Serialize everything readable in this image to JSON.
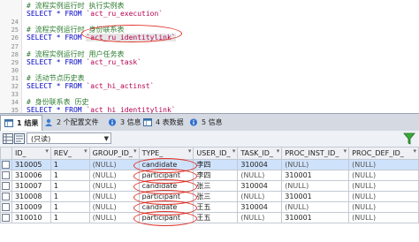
{
  "editor": {
    "lines": [
      {
        "n": "",
        "kind": "comment",
        "text": "# 流程实例运行时 执行实例表"
      },
      {
        "n": "",
        "kind": "sql",
        "kw": "SELECT * FROM ",
        "str": "`act_ru_execution`"
      },
      {
        "n": "24",
        "kind": "blank",
        "text": ""
      },
      {
        "n": "25",
        "kind": "comment",
        "text": "# 流程实例运行时 身份联系表"
      },
      {
        "n": "26",
        "kind": "sql",
        "kw": "SELECT * FROM ",
        "str": "`act_ru_identitylink`"
      },
      {
        "n": "27",
        "kind": "blank",
        "text": ""
      },
      {
        "n": "28",
        "kind": "comment",
        "text": "# 流程实例运行时 用户任务表"
      },
      {
        "n": "29",
        "kind": "sql",
        "kw": "SELECT * FROM ",
        "str": "`act_ru_task`"
      },
      {
        "n": "30",
        "kind": "blank",
        "text": ""
      },
      {
        "n": "31",
        "kind": "comment",
        "text": "# 活动节点历史表"
      },
      {
        "n": "32",
        "kind": "sql",
        "kw": "SELECT * FROM ",
        "str": "`act_hi_actinst`"
      },
      {
        "n": "33",
        "kind": "blank",
        "text": ""
      },
      {
        "n": "34",
        "kind": "comment",
        "text": "# 身份联系表 历史"
      },
      {
        "n": "35",
        "kind": "sql",
        "kw": "SELECT * FROM ",
        "str": "`act_hi_identitylink`"
      }
    ]
  },
  "tabs": [
    {
      "label": "1 结果",
      "icon": "table-icon",
      "active": true
    },
    {
      "label": "2 个配置文件",
      "icon": "profile-icon",
      "active": false
    },
    {
      "label": "3 信息",
      "icon": "info-icon",
      "active": false
    },
    {
      "label": "4 表数据",
      "icon": "table-data-icon",
      "active": false
    },
    {
      "label": "5 信息",
      "icon": "info-icon",
      "active": false
    }
  ],
  "toolbar": {
    "mode_select": "(只读)",
    "icons": [
      "grid-view-icon",
      "text-view-icon"
    ],
    "filter_icon": "filter-icon"
  },
  "grid": {
    "columns": [
      "ID_",
      "REV_",
      "GROUP_ID_",
      "TYPE_",
      "USER_ID_",
      "TASK_ID_",
      "PROC_INST_ID_",
      "PROC_DEF_ID_"
    ],
    "rows": [
      [
        "310005",
        "1",
        "(NULL)",
        "candidate",
        "李四",
        "310004",
        "(NULL)",
        "(NULL)"
      ],
      [
        "310006",
        "1",
        "(NULL)",
        "participant",
        "李四",
        "(NULL)",
        "310001",
        "(NULL)"
      ],
      [
        "310007",
        "1",
        "(NULL)",
        "candidate",
        "张三",
        "310004",
        "(NULL)",
        "(NULL)"
      ],
      [
        "310008",
        "1",
        "(NULL)",
        "participant",
        "张三",
        "(NULL)",
        "310001",
        "(NULL)"
      ],
      [
        "310009",
        "1",
        "(NULL)",
        "candidate",
        "王五",
        "310004",
        "(NULL)",
        "(NULL)"
      ],
      [
        "310010",
        "1",
        "(NULL)",
        "participant",
        "王五",
        "(NULL)",
        "310001",
        "(NULL)"
      ]
    ],
    "selected_row": 0
  },
  "colors": {
    "comment": "#2e7d32",
    "keyword": "#0000c8",
    "string": "#b5004f",
    "highlight_ellipse": "#e0352b",
    "selected_row": "#cfe2fb"
  }
}
